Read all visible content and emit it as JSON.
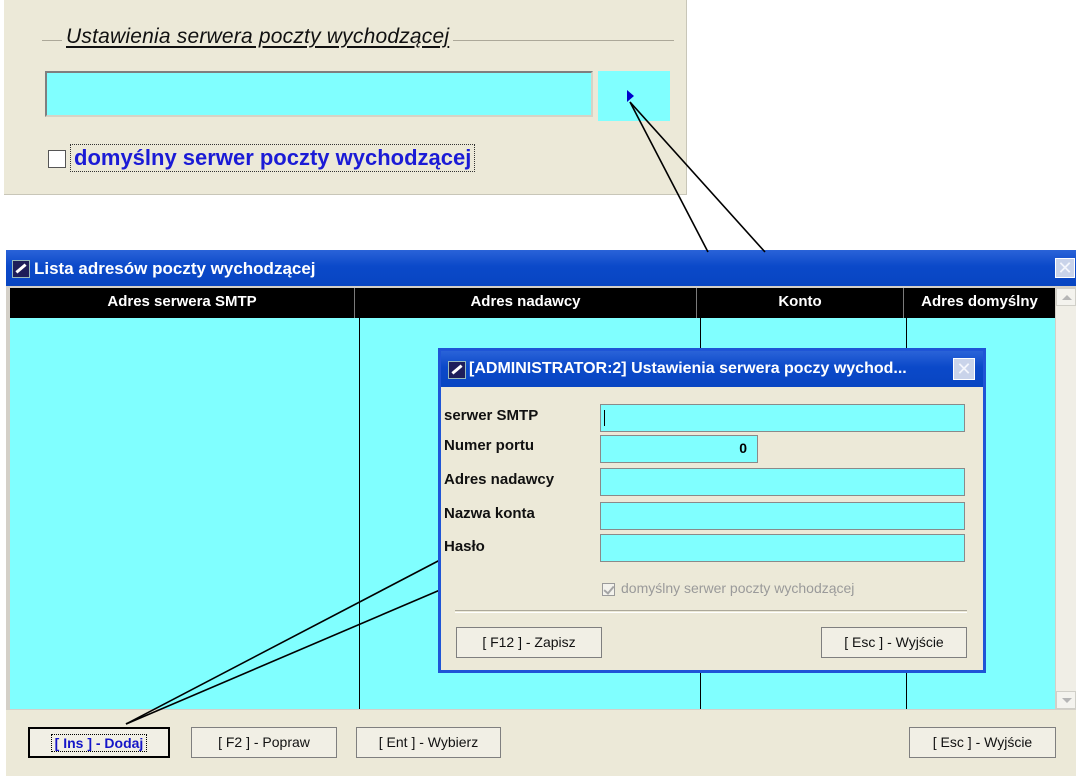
{
  "top_panel": {
    "title": "Ustawienia serwera poczty wychodzącej",
    "checkbox_label": "domyślny serwer poczty wychodzącej",
    "checkbox_checked": false,
    "input_value": ""
  },
  "main_window": {
    "title": "Lista adresów poczty wychodzącej",
    "columns": [
      "Adres serwera SMTP",
      "Adres nadawcy",
      "Konto",
      "Adres domyślny"
    ],
    "rows": [],
    "buttons": {
      "add": "[ Ins ] - Dodaj",
      "edit": "[ F2 ] - Popraw",
      "select": "[ Ent ] - Wybierz",
      "exit": "[ Esc ] - Wyjście"
    }
  },
  "dialog": {
    "title": "[ADMINISTRATOR:2]  Ustawienia serwera poczy wychod...",
    "fields": [
      {
        "label": "serwer SMTP",
        "value": ""
      },
      {
        "label": "Numer portu",
        "value": "0"
      },
      {
        "label": "Adres nadawcy",
        "value": ""
      },
      {
        "label": "Nazwa konta",
        "value": ""
      },
      {
        "label": "Hasło",
        "value": ""
      }
    ],
    "checkbox_label": "domyślny serwer poczty wychodzącej",
    "checkbox_checked": true,
    "checkbox_disabled": true,
    "buttons": {
      "save": "[ F12 ] - Zapisz",
      "exit": "[ Esc ] - Wyjście"
    }
  },
  "colors": {
    "field_bg": "#80ffff",
    "titlebar": "#0b49c9",
    "panel_bg": "#ece9d8",
    "link_blue": "#1b1bd6"
  }
}
